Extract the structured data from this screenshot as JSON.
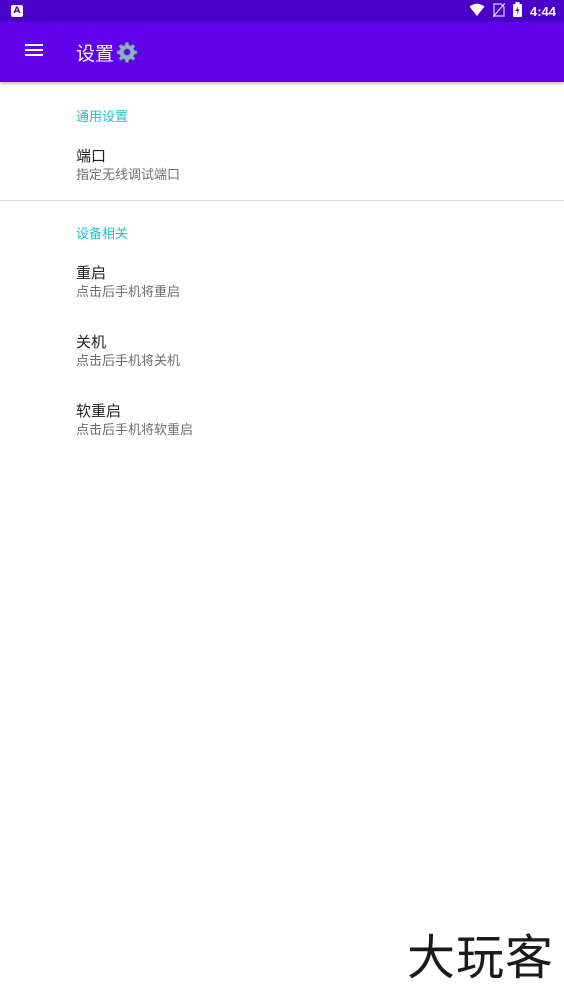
{
  "status_bar": {
    "app_icon_letter": "A",
    "time": "4:44"
  },
  "app_bar": {
    "title": "设置",
    "title_icon": "gear-icon"
  },
  "sections": [
    {
      "header": "通用设置",
      "items": [
        {
          "title": "端口",
          "summary": "指定无线调试端口"
        }
      ]
    },
    {
      "header": "设备相关",
      "items": [
        {
          "title": "重启",
          "summary": "点击后手机将重启"
        },
        {
          "title": "关机",
          "summary": "点击后手机将关机"
        },
        {
          "title": "软重启",
          "summary": "点击后手机将软重启"
        }
      ]
    }
  ],
  "watermark": "大玩客",
  "colors": {
    "status_bar": "#4a00c8",
    "app_bar": "#6200ea",
    "section_header": "#1cc4c8"
  }
}
